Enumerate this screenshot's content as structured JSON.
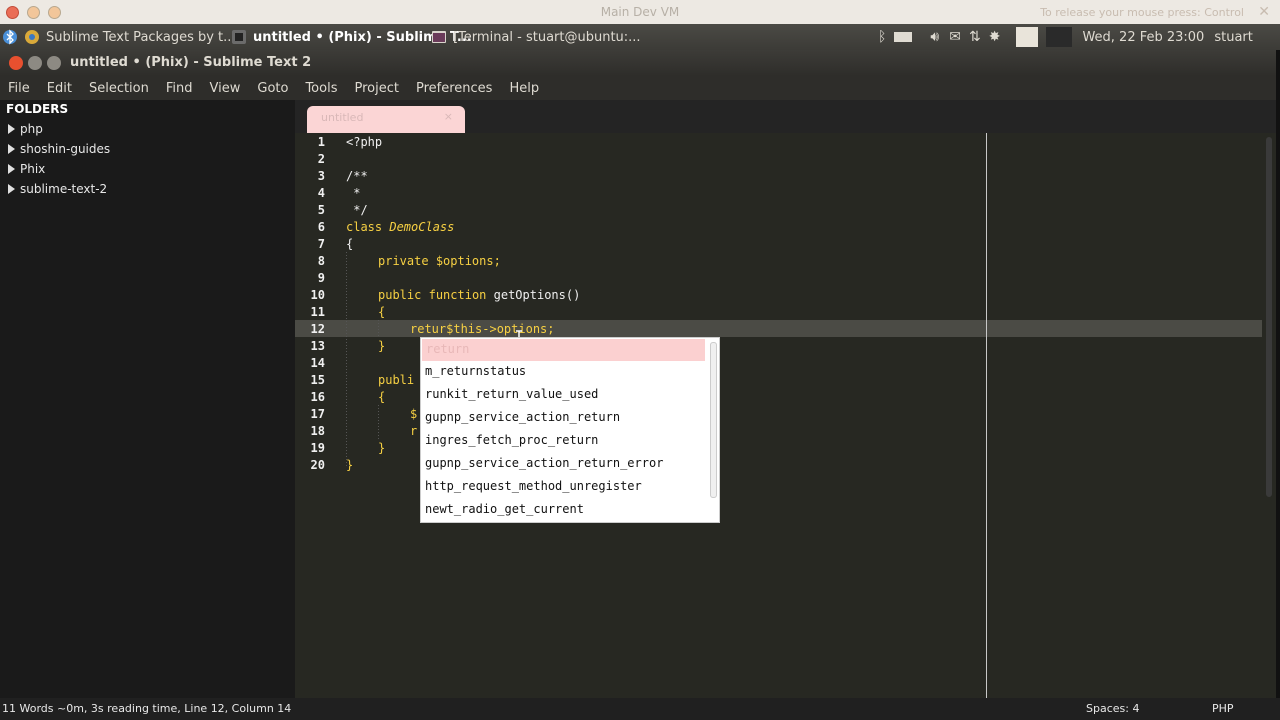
{
  "vm": {
    "title": "Main Dev VM",
    "hint": "To release your mouse press: Control",
    "close_glyph": "✕"
  },
  "taskbar": {
    "tasks": [
      {
        "label": "Sublime Text Packages by t...",
        "icon": "chrome-icon",
        "color": "#e0b040"
      },
      {
        "label": "untitled • (Phix) - Sublime T...",
        "icon": "sublime-icon",
        "color": "#555"
      },
      {
        "label": "[Terminal - stuart@ubuntu:...",
        "icon": "terminal-icon",
        "color": "#555"
      }
    ],
    "clock": "Wed, 22 Feb  23:00",
    "user": "stuart"
  },
  "window": {
    "title": "untitled • (Phix) - Sublime Text 2"
  },
  "menu": [
    "File",
    "Edit",
    "Selection",
    "Find",
    "View",
    "Goto",
    "Tools",
    "Project",
    "Preferences",
    "Help"
  ],
  "sidebar": {
    "heading": "FOLDERS",
    "folders": [
      "php",
      "shoshin-guides",
      "Phix",
      "sublime-text-2"
    ]
  },
  "editor": {
    "tab_label": "untitled",
    "tab_close": "×",
    "line_numbers": [
      "1",
      "2",
      "3",
      "4",
      "5",
      "6",
      "7",
      "8",
      "9",
      "10",
      "11",
      "12",
      "13",
      "14",
      "15",
      "16",
      "17",
      "18",
      "19",
      "20"
    ],
    "current_line": 12
  },
  "code": {
    "l1": "<?php",
    "l3": "/**",
    "l4": " *",
    "l5": " */",
    "l6_kw": "class",
    "l6_name": "DemoClass",
    "l7": "{",
    "l8_kw": "private",
    "l8_var": "$options;",
    "l10_kw1": "public",
    "l10_kw2": "function",
    "l10_name": "getOptions",
    "l10_rest": "()",
    "l11": "{",
    "l12_kw": "retur",
    "l12_rest": "$this->options;",
    "l13": "}",
    "l15": "publi",
    "l16": "{",
    "l17": "$",
    "l18": "r",
    "l19": "}",
    "l20": "}"
  },
  "autocomplete": {
    "selected": "return",
    "items": [
      "m_returnstatus",
      "runkit_return_value_used",
      "gupnp_service_action_return",
      "ingres_fetch_proc_return",
      "gupnp_service_action_return_error",
      "http_request_method_unregister",
      "newt_radio_get_current"
    ]
  },
  "status": {
    "left": "11 Words ~0m, 3s reading time, Line 12, Column 14",
    "spaces": "Spaces: 4",
    "syntax": "PHP"
  }
}
